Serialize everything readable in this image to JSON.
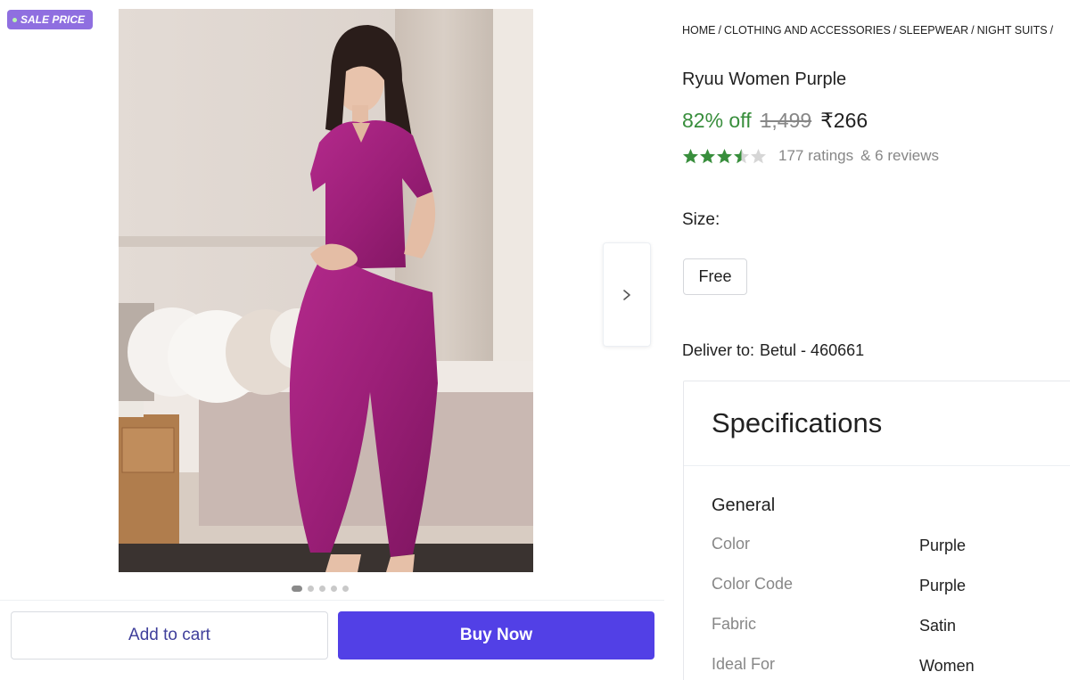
{
  "badge": {
    "label": "SALE PRICE"
  },
  "gallery": {
    "image_count": 5,
    "active_index": 0
  },
  "actions": {
    "add_to_cart": "Add to cart",
    "buy_now": "Buy Now"
  },
  "breadcrumb": [
    "HOME",
    "CLOTHING AND ACCESSORIES",
    "SLEEPWEAR",
    "NIGHT SUITS"
  ],
  "product": {
    "title": "Ryuu Women Purple",
    "discount": "82% off",
    "mrp": "1,499",
    "price": "₹266",
    "rating_value": 3.5,
    "ratings": "177 ratings",
    "reviews": "& 6 reviews"
  },
  "size": {
    "label": "Size:",
    "options": [
      "Free"
    ]
  },
  "delivery": {
    "label": "Deliver to:",
    "location": "Betul - 460661"
  },
  "specifications": {
    "title": "Specifications",
    "section": "General",
    "rows": [
      {
        "key": "Color",
        "value": "Purple"
      },
      {
        "key": "Color Code",
        "value": "Purple"
      },
      {
        "key": "Fabric",
        "value": "Satin"
      },
      {
        "key": "Ideal For",
        "value": "Women"
      }
    ]
  },
  "colors": {
    "accent": "#5240e6",
    "badge": "#8f6fe0",
    "discount": "#388e3c",
    "star": "#388e3c",
    "garment": "#a3237f"
  },
  "icons": {
    "next": "chevron-right-icon",
    "star": "star-icon"
  }
}
